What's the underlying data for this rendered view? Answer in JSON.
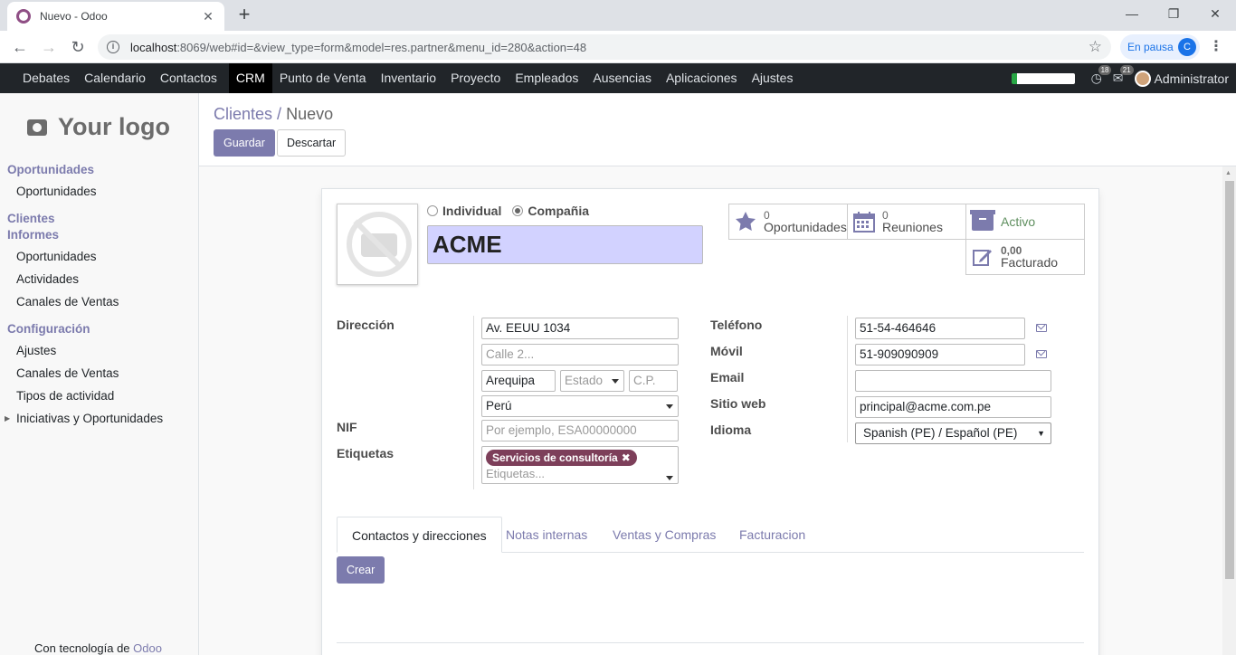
{
  "browser": {
    "tab_title": "Nuevo - Odoo",
    "url_host": "localhost",
    "url_rest": ":8069/web#id=&view_type=form&model=res.partner&menu_id=280&action=48",
    "profile_status": "En pausa",
    "profile_initial": "C"
  },
  "topnav": {
    "items": [
      "Debates",
      "Calendario",
      "Contactos",
      "CRM",
      "Punto de Venta",
      "Inventario",
      "Proyecto",
      "Empleados",
      "Ausencias",
      "Aplicaciones",
      "Ajustes"
    ],
    "active": "CRM",
    "activity_count": "18",
    "message_count": "21",
    "user": "Administrator"
  },
  "sidebar": {
    "logo_text": "Your logo",
    "sections": [
      {
        "title": "Oportunidades",
        "items": [
          "Oportunidades"
        ]
      },
      {
        "title": "Clientes",
        "items": []
      },
      {
        "title": "Informes",
        "items": [
          "Oportunidades",
          "Actividades",
          "Canales de Ventas"
        ]
      },
      {
        "title": "Configuración",
        "items": [
          "Ajustes",
          "Canales de Ventas",
          "Tipos de actividad",
          "Iniciativas y Oportunidades"
        ]
      }
    ],
    "powered_prefix": "Con tecnología de",
    "powered_brand": "Odoo"
  },
  "control_panel": {
    "breadcrumb_parent": "Clientes",
    "breadcrumb_separator": "/",
    "breadcrumb_current": "Nuevo",
    "save_label": "Guardar",
    "discard_label": "Descartar"
  },
  "form": {
    "type_individual": "Individual",
    "type_company": "Compañia",
    "selected_type": "Compañia",
    "name": "ACME",
    "stats": {
      "opportunities": {
        "count": "0",
        "label": "Oportunidades"
      },
      "meetings": {
        "count": "0",
        "label": "Reuniones"
      },
      "active": {
        "label": "Activo"
      },
      "invoiced": {
        "count": "0,00",
        "label": "Facturado"
      }
    },
    "labels": {
      "address": "Dirección",
      "vat": "NIF",
      "tags": "Etiquetas",
      "phone": "Teléfono",
      "mobile": "Móvil",
      "email": "Email",
      "website": "Sitio web",
      "language": "Idioma"
    },
    "values": {
      "street": "Av. EEUU 1034",
      "street2_placeholder": "Calle 2...",
      "city": "Arequipa",
      "state_placeholder": "Estado",
      "zip_placeholder": "C.P.",
      "country": "Perú",
      "vat_placeholder": "Por ejemplo, ESA00000000",
      "tag": "Servicios de consultoría",
      "tags_placeholder": "Etiquetas...",
      "phone": "51-54-464646",
      "mobile": "51-909090909",
      "email": "",
      "website": "principal@acme.com.pe",
      "language": "Spanish (PE) / Español (PE)"
    },
    "tabs": [
      "Contactos y direcciones",
      "Notas internas",
      "Ventas y Compras",
      "Facturacion"
    ],
    "active_tab": "Contactos y direcciones",
    "create_label": "Crear"
  }
}
